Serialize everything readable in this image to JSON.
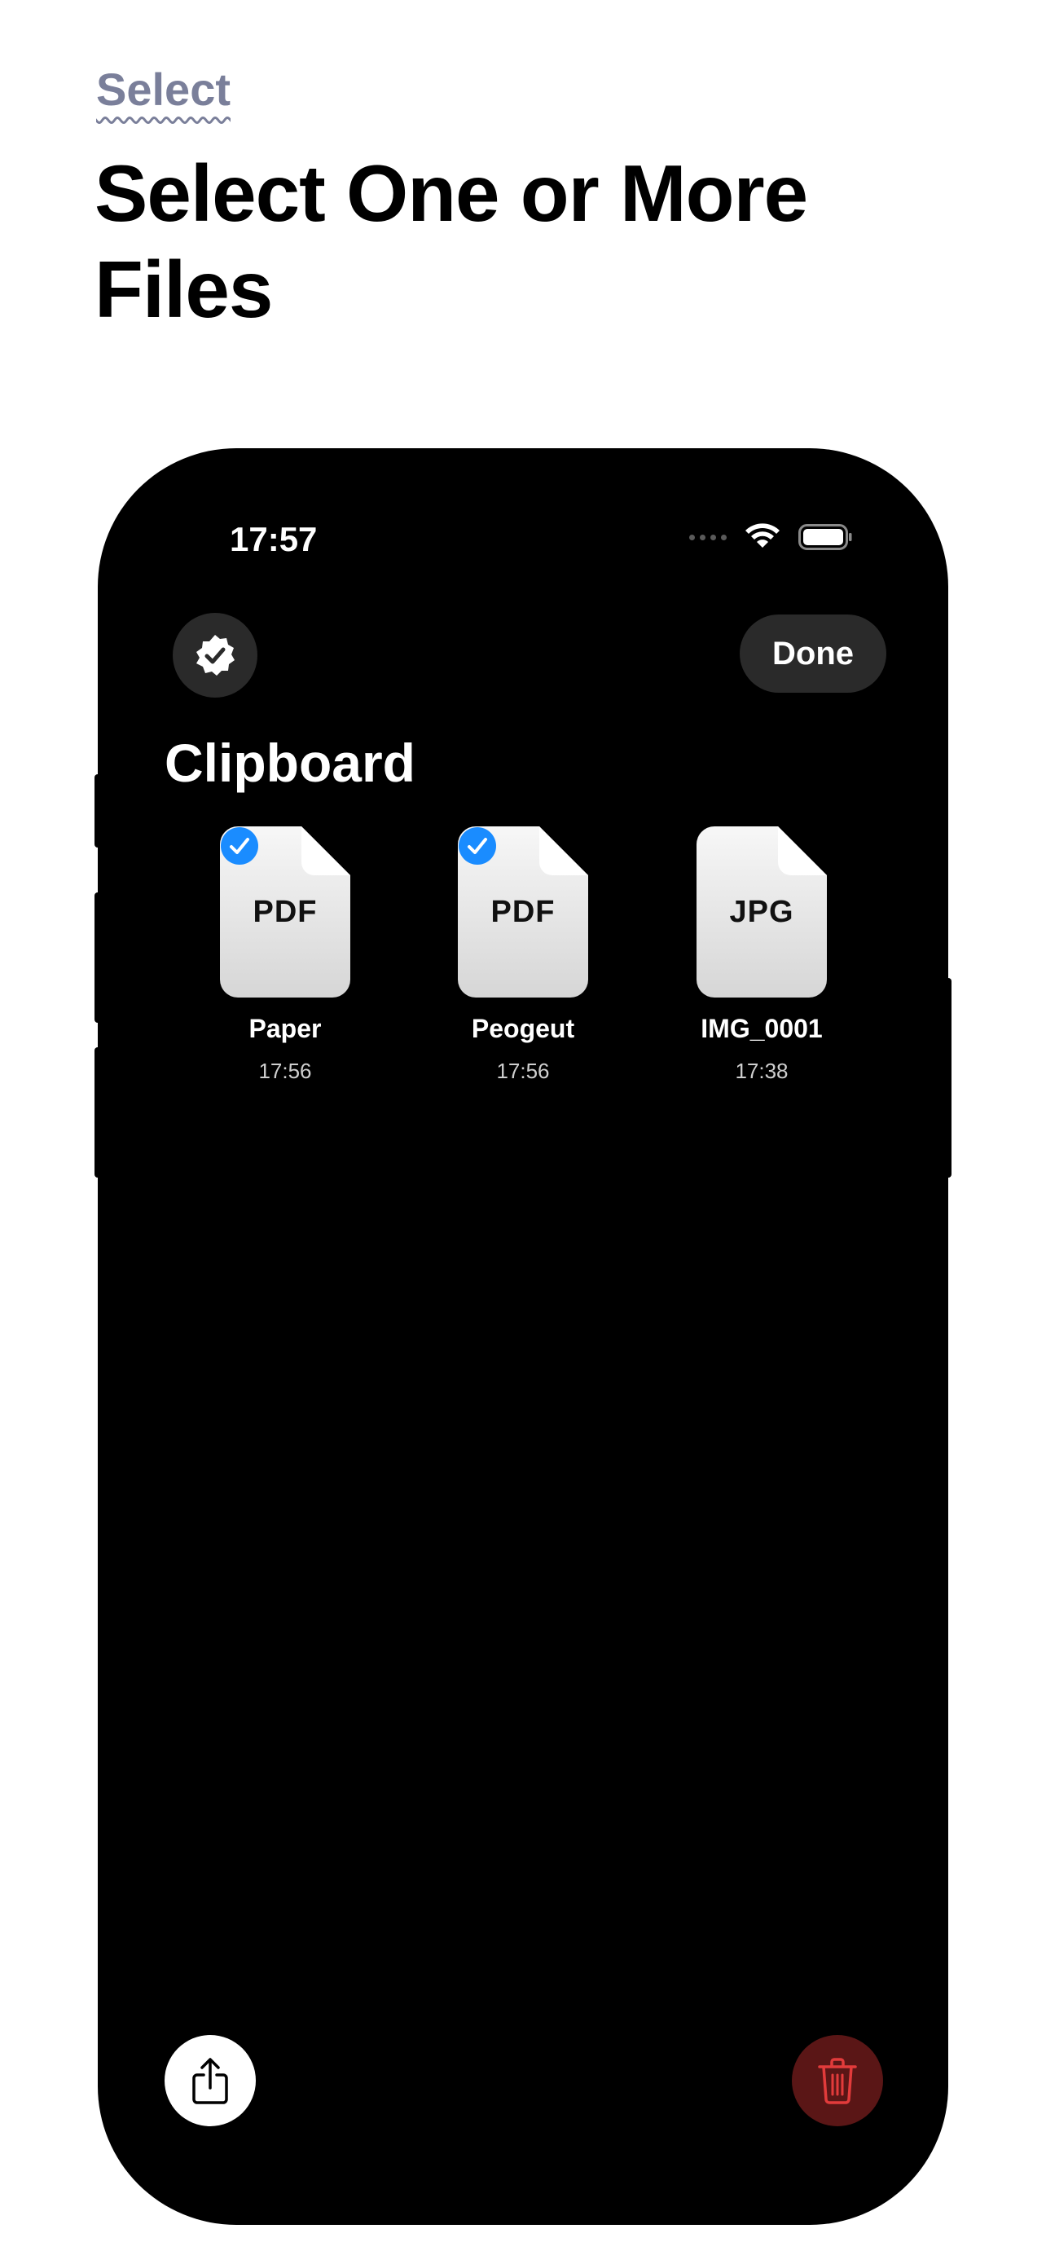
{
  "header": {
    "eyebrow": "Select",
    "headline": "Select One or More Files"
  },
  "status_bar": {
    "time": "17:57"
  },
  "toolbar": {
    "done_label": "Done"
  },
  "section": {
    "title": "Clipboard"
  },
  "files": [
    {
      "type": "PDF",
      "name": "Paper",
      "time": "17:56",
      "selected": true
    },
    {
      "type": "PDF",
      "name": "Peogeut",
      "time": "17:56",
      "selected": true
    },
    {
      "type": "JPG",
      "name": "IMG_0001",
      "time": "17:38",
      "selected": false
    }
  ],
  "colors": {
    "accent": "#1a8cff",
    "eyebrow": "#7a7f9a",
    "danger": "#e23b3b",
    "danger_bg": "#5a1616"
  }
}
